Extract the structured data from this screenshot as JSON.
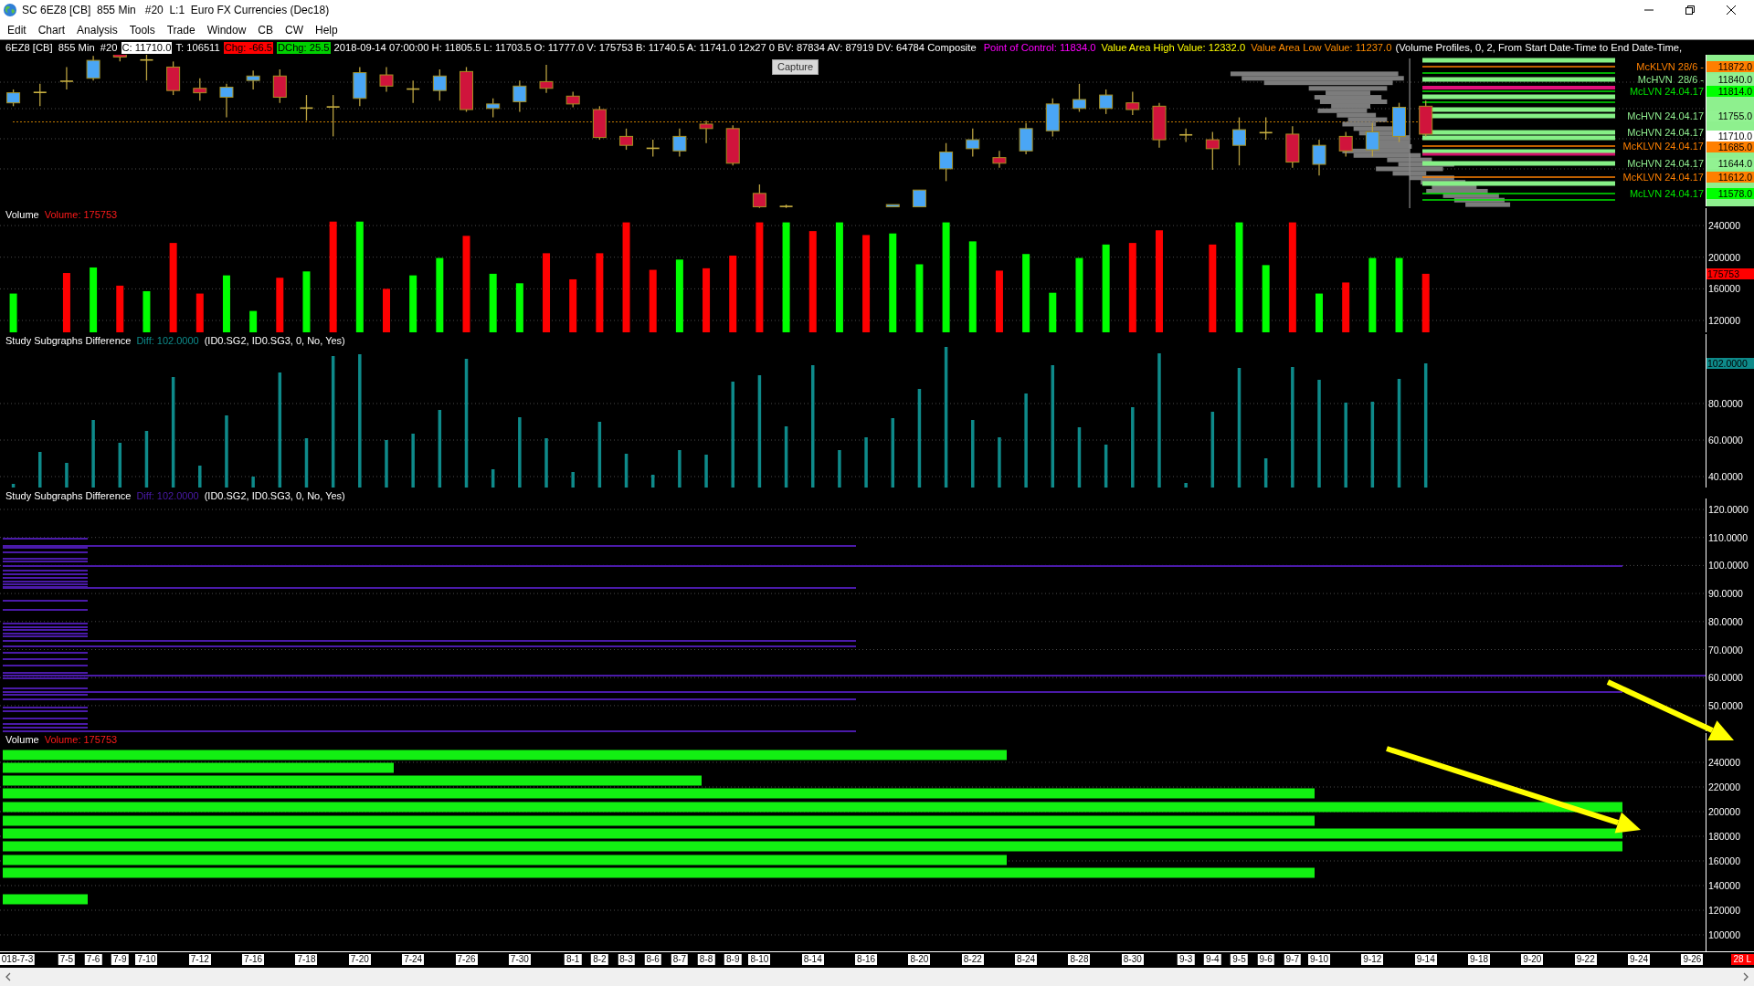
{
  "window": {
    "title": "SC 6EZ8 [CB]  855 Min   #20  L:1  Euro FX Currencies (Dec18)"
  },
  "menu": [
    "Edit",
    "Chart",
    "Analysis",
    "Tools",
    "Trade",
    "Window",
    "CB",
    "CW",
    "Help"
  ],
  "chart_header": [
    {
      "text": "6EZ8 [CB]  855 Min  #20",
      "kind": "plain"
    },
    {
      "text": "C: 11710.0",
      "kind": "close"
    },
    {
      "text": "T: 106511",
      "kind": "plain"
    },
    {
      "text": "Chg: -66.5",
      "kind": "change"
    },
    {
      "text": "DChg: 25.5",
      "kind": "daychange"
    },
    {
      "text": "2018-09-14 07:00:00 H: 11805.5 L: 11703.5 O: 11777.0 V: 175753 B: 11740.5 A: 11741.0 12x27 0 BV: 87834 AV: 87919 DV: 64784 Composite",
      "kind": "plain"
    },
    {
      "text": "Point of Control: 11834.0",
      "kind": "poc"
    },
    {
      "text": "Value Area High Value: 12332.0",
      "kind": "vahigh"
    },
    {
      "text": "Value Area Low Value: 11237.0",
      "kind": "valow"
    },
    {
      "text": "(Volume Profiles, 0, 2, From Start Date-Time to End Date-Time,",
      "kind": "plain"
    }
  ],
  "price_pane": {
    "capture_button": "Capture",
    "levels": [
      {
        "label": "McKLVN 28/6 -",
        "kind": "klvn"
      },
      {
        "label": "McHVN  28/6 -",
        "kind": "hvn"
      },
      {
        "label": "McLVN 24.04.17",
        "kind": "lvn"
      },
      {
        "label": "McHVN 24.04.17",
        "kind": "hvn"
      },
      {
        "label": "McHVN 24.04.17",
        "kind": "hvn"
      },
      {
        "label": "McKLVN 24.04.17",
        "kind": "klvn"
      },
      {
        "label": "McHVN 24.04.17",
        "kind": "hvn"
      },
      {
        "label": "McKLVN 24.04.17",
        "kind": "klvn"
      },
      {
        "label": "McLVN 24.04.17",
        "kind": "lvn"
      }
    ],
    "price_labels": [
      {
        "text": "11872.0",
        "kind": "klvn"
      },
      {
        "text": "11840.0",
        "kind": "hvn"
      },
      {
        "text": "11814.0",
        "kind": "lvn"
      },
      {
        "text": "11755.0",
        "kind": "hvn"
      },
      {
        "text": "11710.0",
        "kind": "last"
      },
      {
        "text": "11685.0",
        "kind": "klvn"
      },
      {
        "text": "11644.0",
        "kind": "hvn"
      },
      {
        "text": "11612.0",
        "kind": "klvn"
      },
      {
        "text": "11578.0",
        "kind": "lvn"
      }
    ]
  },
  "volume_pane": {
    "title": "Volume",
    "reading": "Volume: 175753",
    "last_value": "175753",
    "chart_data": {
      "type": "bar",
      "grid": true,
      "categories": [
        null,
        null,
        null,
        null,
        null,
        null,
        null,
        null,
        null,
        null,
        null,
        null,
        null,
        null,
        null,
        null,
        null,
        null,
        null,
        null,
        null,
        null,
        null,
        null,
        null,
        null,
        null,
        null,
        null,
        null,
        null,
        null,
        null,
        null,
        null,
        null,
        null,
        null,
        null,
        null,
        null,
        null,
        null,
        null,
        null,
        null,
        null,
        null,
        null,
        null,
        null,
        null,
        null,
        null,
        null,
        null,
        null,
        null,
        null,
        null,
        null,
        null,
        null,
        null
      ],
      "ylim": [
        105000,
        262000
      ],
      "yticks": [
        {
          "value": 240000,
          "label": "240000"
        },
        {
          "value": 200000,
          "label": "200000"
        },
        {
          "value": 160000,
          "label": "160000"
        },
        {
          "value": 120000,
          "label": "120000"
        }
      ],
      "series": [
        {
          "color": "#00ff00",
          "values": [
            154000,
            null,
            null,
            187000,
            null,
            157000,
            null,
            null,
            177000,
            132000,
            null,
            182000,
            null,
            245000,
            null,
            177000,
            199000,
            null,
            179000,
            167000,
            null,
            null,
            null,
            null,
            null,
            197000,
            null,
            null,
            null,
            244000,
            null,
            244000,
            null,
            230000,
            191000,
            244000,
            220000,
            null,
            204000,
            155000,
            199000,
            216000,
            null,
            null,
            null,
            null,
            244000,
            190000,
            null,
            154000,
            null,
            199000,
            199000,
            null,
            null,
            null,
            null,
            null,
            null,
            null,
            null,
            null,
            null,
            null
          ]
        },
        {
          "color": "#ff0000",
          "values": [
            null,
            null,
            180000,
            null,
            164000,
            null,
            218000,
            154000,
            null,
            null,
            174000,
            null,
            245000,
            null,
            160000,
            null,
            null,
            227000,
            null,
            null,
            205000,
            172000,
            205000,
            244000,
            184000,
            null,
            186000,
            202000,
            244000,
            null,
            233000,
            null,
            228000,
            null,
            null,
            null,
            null,
            183000,
            null,
            null,
            null,
            null,
            218000,
            234000,
            null,
            216000,
            null,
            null,
            244000,
            null,
            168000,
            null,
            null,
            179000,
            null,
            null,
            null,
            null,
            null,
            null,
            null,
            null,
            null,
            null
          ]
        }
      ]
    }
  },
  "difference_pane": {
    "title": "Study Subgraphs Difference",
    "reading": "Diff: 102.0000",
    "inputs": "(ID0.SG2, ID0.SG3, 0, No, Yes)",
    "last_value": "102.0000",
    "chart_data": {
      "type": "bar",
      "grid": true,
      "categories": [
        null,
        null,
        null,
        null,
        null,
        null,
        null,
        null,
        null,
        null,
        null,
        null,
        null,
        null,
        null,
        null,
        null,
        null,
        null,
        null,
        null,
        null,
        null,
        null,
        null,
        null,
        null,
        null,
        null,
        null,
        null,
        null,
        null,
        null,
        null,
        null,
        null,
        null,
        null,
        null,
        null,
        null,
        null,
        null,
        null,
        null,
        null,
        null,
        null,
        null,
        null,
        null,
        null,
        null,
        null,
        null,
        null,
        null,
        null,
        null,
        null,
        null,
        null,
        null
      ],
      "ylim": [
        34,
        118
      ],
      "yticks": [
        {
          "value": 80,
          "label": "80.0000"
        },
        {
          "value": 60,
          "label": "60.0000"
        },
        {
          "value": 40,
          "label": "40.0000"
        }
      ],
      "series": [
        {
          "color": "#0e8a8a",
          "values": [
            36,
            53.5,
            47.5,
            71,
            58.5,
            65,
            94.5,
            46,
            73.5,
            40,
            97,
            61,
            106,
            107,
            60,
            63.5,
            76.5,
            104.5,
            44,
            72.5,
            61,
            42.5,
            70,
            52.5,
            41,
            54.5,
            52,
            92,
            95.5,
            67.5,
            101,
            54.5,
            61.5,
            72,
            88,
            111,
            71,
            61.5,
            85.5,
            101,
            67,
            57.5,
            78,
            107.5,
            36.5,
            75.5,
            99.5,
            50,
            100,
            93,
            80.5,
            81,
            93.5,
            102,
            null,
            null,
            null,
            null,
            null,
            null,
            null,
            null,
            null,
            null
          ]
        }
      ]
    }
  },
  "difference_pane_2": {
    "title": "Study Subgraphs Difference",
    "reading": "Diff: 102.0000",
    "inputs": "(ID0.SG2, ID0.SG3, 0, No, Yes)",
    "color": "#4a1aa8",
    "axis_labels": [
      "120.0000",
      "110.0000",
      "100.0000",
      "90.0000",
      "80.0000",
      "70.0000",
      "60.0000",
      "50.0000"
    ]
  },
  "volume_pane_2": {
    "title": "Volume",
    "reading": "Volume: 175753",
    "axis_labels": [
      "240000",
      "220000",
      "200000",
      "180000",
      "160000",
      "140000",
      "120000",
      "100000"
    ]
  },
  "time_axis": {
    "labels": [
      "018-7-3",
      "7-5",
      "7-6",
      "7-9",
      "7-10",
      "7-12",
      "7-16",
      "7-18",
      "7-20",
      "7-24",
      "7-26",
      "7-30",
      "8-1",
      "8-2",
      "8-3",
      "8-6",
      "8-7",
      "8-8",
      "8-9",
      "8-10",
      "8-14",
      "8-16",
      "8-20",
      "8-22",
      "8-24",
      "8-28",
      "8-30",
      "9-3",
      "9-4",
      "9-5",
      "9-6",
      "9-7",
      "9-10",
      "9-12",
      "9-14",
      "9-18",
      "9-20",
      "9-22",
      "9-24",
      "9-26"
    ],
    "marker": "28 L"
  },
  "annotations": [
    {
      "kind": "arrow"
    },
    {
      "kind": "arrow"
    }
  ]
}
